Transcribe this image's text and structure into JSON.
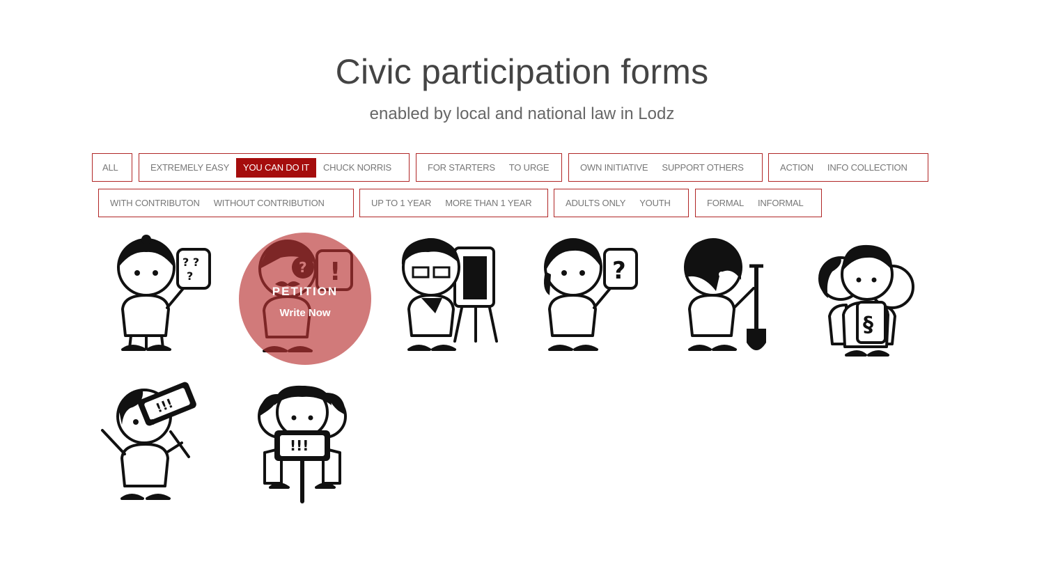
{
  "header": {
    "title": "Civic participation forms",
    "subtitle": "enabled by local and national law in Lodz"
  },
  "filters": {
    "row1": [
      [
        "ALL"
      ],
      [
        "EXTREMELY EASY",
        "YOU CAN DO IT",
        "CHUCK NORRIS"
      ],
      [
        "FOR STARTERS",
        "TO URGE"
      ],
      [
        "OWN INITIATIVE",
        "SUPPORT OTHERS"
      ],
      [
        "ACTION",
        "INFO COLLECTION"
      ]
    ],
    "row2": [
      [
        "WITH CONTRIBUTON",
        "WITHOUT CONTRIBUTION"
      ],
      [
        "UP TO 1 YEAR",
        "MORE THAN 1 YEAR"
      ],
      [
        "ADULTS ONLY",
        "YOUTH"
      ],
      [
        "FORMAL",
        "INFORMAL"
      ]
    ],
    "active": "YOU CAN DO IT"
  },
  "hover_card": {
    "title": "PETITION",
    "action": "Write Now"
  },
  "cards": [
    {
      "icon": "person-with-question-document-icon"
    },
    {
      "icon": "person-with-mustache-petition-icon"
    },
    {
      "icon": "person-with-glasses-easel-icon"
    },
    {
      "icon": "person-with-question-sign-icon"
    },
    {
      "icon": "person-with-shovel-icon"
    },
    {
      "icon": "group-with-paragraph-sign-icon"
    },
    {
      "icon": "person-with-protest-sign-icon"
    },
    {
      "icon": "group-with-protest-banner-icon"
    }
  ],
  "colors": {
    "accent": "#a50d0d",
    "border": "#b02525",
    "overlay": "#b93232"
  }
}
